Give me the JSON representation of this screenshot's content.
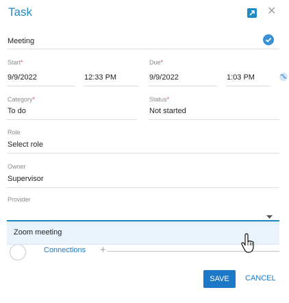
{
  "header": {
    "title": "Task"
  },
  "subject": {
    "value": "Meeting"
  },
  "start": {
    "label": "Start",
    "date": "9/9/2022",
    "time": "12:33 PM"
  },
  "due": {
    "label": "Due",
    "date": "9/9/2022",
    "time": "1:03 PM"
  },
  "category": {
    "label": "Category",
    "value": "To do"
  },
  "status": {
    "label": "Status",
    "value": "Not started"
  },
  "role": {
    "label": "Role",
    "placeholder": "Select role"
  },
  "owner": {
    "label": "Owner",
    "value": "Supervisor"
  },
  "provider": {
    "label": "Provider",
    "value": ""
  },
  "dropdown": {
    "options": [
      "Zoom meeting"
    ]
  },
  "connections": {
    "label": "Connections",
    "add_symbol": "+"
  },
  "footer": {
    "save_label": "SAVE",
    "cancel_label": "CANCEL"
  },
  "required_mark": "*",
  "colors": {
    "accent": "#1e8bc3",
    "button": "#1e78c8",
    "required": "#e04b4b",
    "dropdown_highlight": "#eaf2fb"
  },
  "icons": [
    "expand-icon",
    "close-icon",
    "check-icon",
    "globe-icon",
    "chevron-down-icon",
    "connection-icon",
    "pointer-cursor-icon"
  ]
}
